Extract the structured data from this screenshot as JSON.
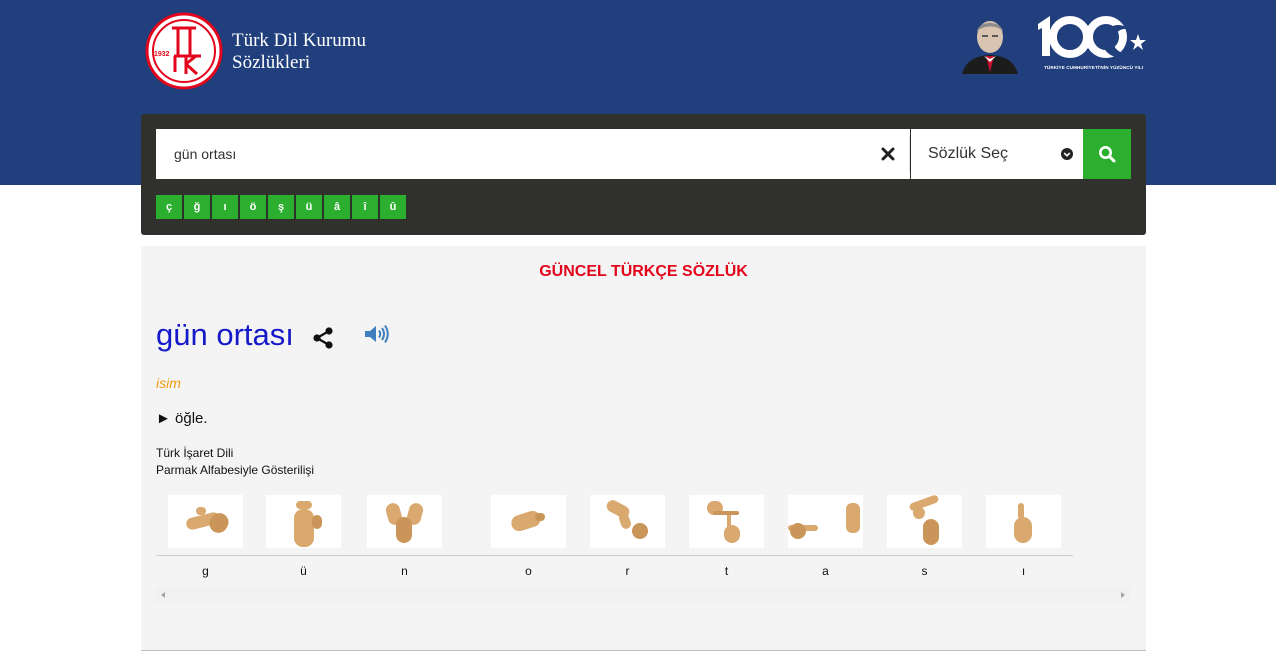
{
  "header": {
    "brand_line1": "Türk Dil Kurumu",
    "brand_line2": "Sözlükleri",
    "logo_text": "TDK",
    "logo_year": "1932",
    "centennial_number": "100",
    "centennial_caption": "TÜRKİYE CUMHURİYETİ'NİN YÜZÜNCÜ YILI"
  },
  "search": {
    "query": "gün ortası",
    "dictionary_select": "Sözlük Seç",
    "special_chars": [
      "ç",
      "ğ",
      "ı",
      "ö",
      "ş",
      "ü",
      "â",
      "î",
      "û"
    ]
  },
  "entry": {
    "dictionary_title": "GÜNCEL TÜRKÇE SÖZLÜK",
    "headword": "gün ortası",
    "part_of_speech": "isim",
    "meaning": "► öğle.",
    "sign_title_line1": "Türk İşaret Dili",
    "sign_title_line2": "Parmak Alfabesiyle Gösterilişi",
    "sign_letters": [
      "g",
      "ü",
      "n",
      "o",
      "r",
      "t",
      "a",
      "s",
      "ı"
    ]
  },
  "colors": {
    "header_blue": "#213f7c",
    "panel_dark": "#30302d",
    "accent_green": "#2cae2e",
    "title_red": "#e3051b",
    "headword_blue": "#1519c8",
    "pos_orange": "#f39c12",
    "speaker_blue": "#3f7fc0"
  },
  "icons": {
    "clear": "close-icon",
    "dropdown": "chevron-down-circle-icon",
    "search": "search-icon",
    "share": "share-icon",
    "audio": "speaker-icon"
  }
}
